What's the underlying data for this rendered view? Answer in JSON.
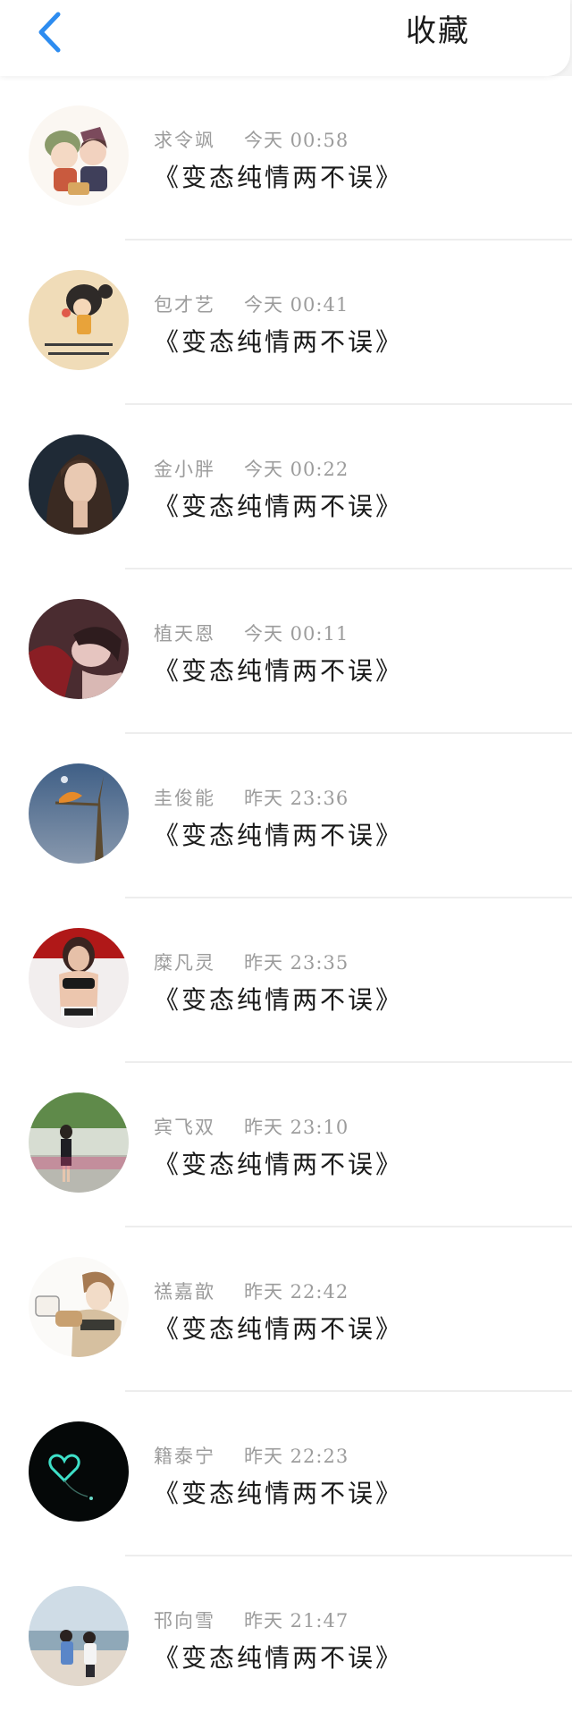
{
  "header": {
    "title": "收藏",
    "back_icon": "chevron-left-icon",
    "accent_color": "#2d8cf0"
  },
  "favorites": [
    {
      "name": "求令飒",
      "time": "今天 00:58",
      "title": "《变态纯情两不误》",
      "avatar": "anime-couple-avatar"
    },
    {
      "name": "包才艺",
      "time": "今天 00:41",
      "title": "《变态纯情两不误》",
      "avatar": "cartoon-girl-text-avatar"
    },
    {
      "name": "金小胖",
      "time": "今天 00:22",
      "title": "《变态纯情两不误》",
      "avatar": "woman-portrait-avatar"
    },
    {
      "name": "植天恩",
      "time": "今天 00:11",
      "title": "《变态纯情两不误》",
      "avatar": "woman-red-avatar"
    },
    {
      "name": "圭俊能",
      "time": "昨天 23:36",
      "title": "《变态纯情两不误》",
      "avatar": "bird-branch-avatar"
    },
    {
      "name": "糜凡灵",
      "time": "昨天 23:35",
      "title": "《变态纯情两不误》",
      "avatar": "woman-bikini-avatar"
    },
    {
      "name": "宾飞双",
      "time": "昨天 23:10",
      "title": "《变态纯情两不误》",
      "avatar": "girl-garden-avatar"
    },
    {
      "name": "禚嘉歆",
      "time": "昨天 22:42",
      "title": "《变态纯情两不误》",
      "avatar": "anime-boy-cup-avatar"
    },
    {
      "name": "籍泰宁",
      "time": "昨天 22:23",
      "title": "《变态纯情两不误》",
      "avatar": "neon-heart-avatar"
    },
    {
      "name": "邗向雪",
      "time": "昨天 21:47",
      "title": "《变态纯情两不误》",
      "avatar": "beach-couple-avatar"
    }
  ]
}
